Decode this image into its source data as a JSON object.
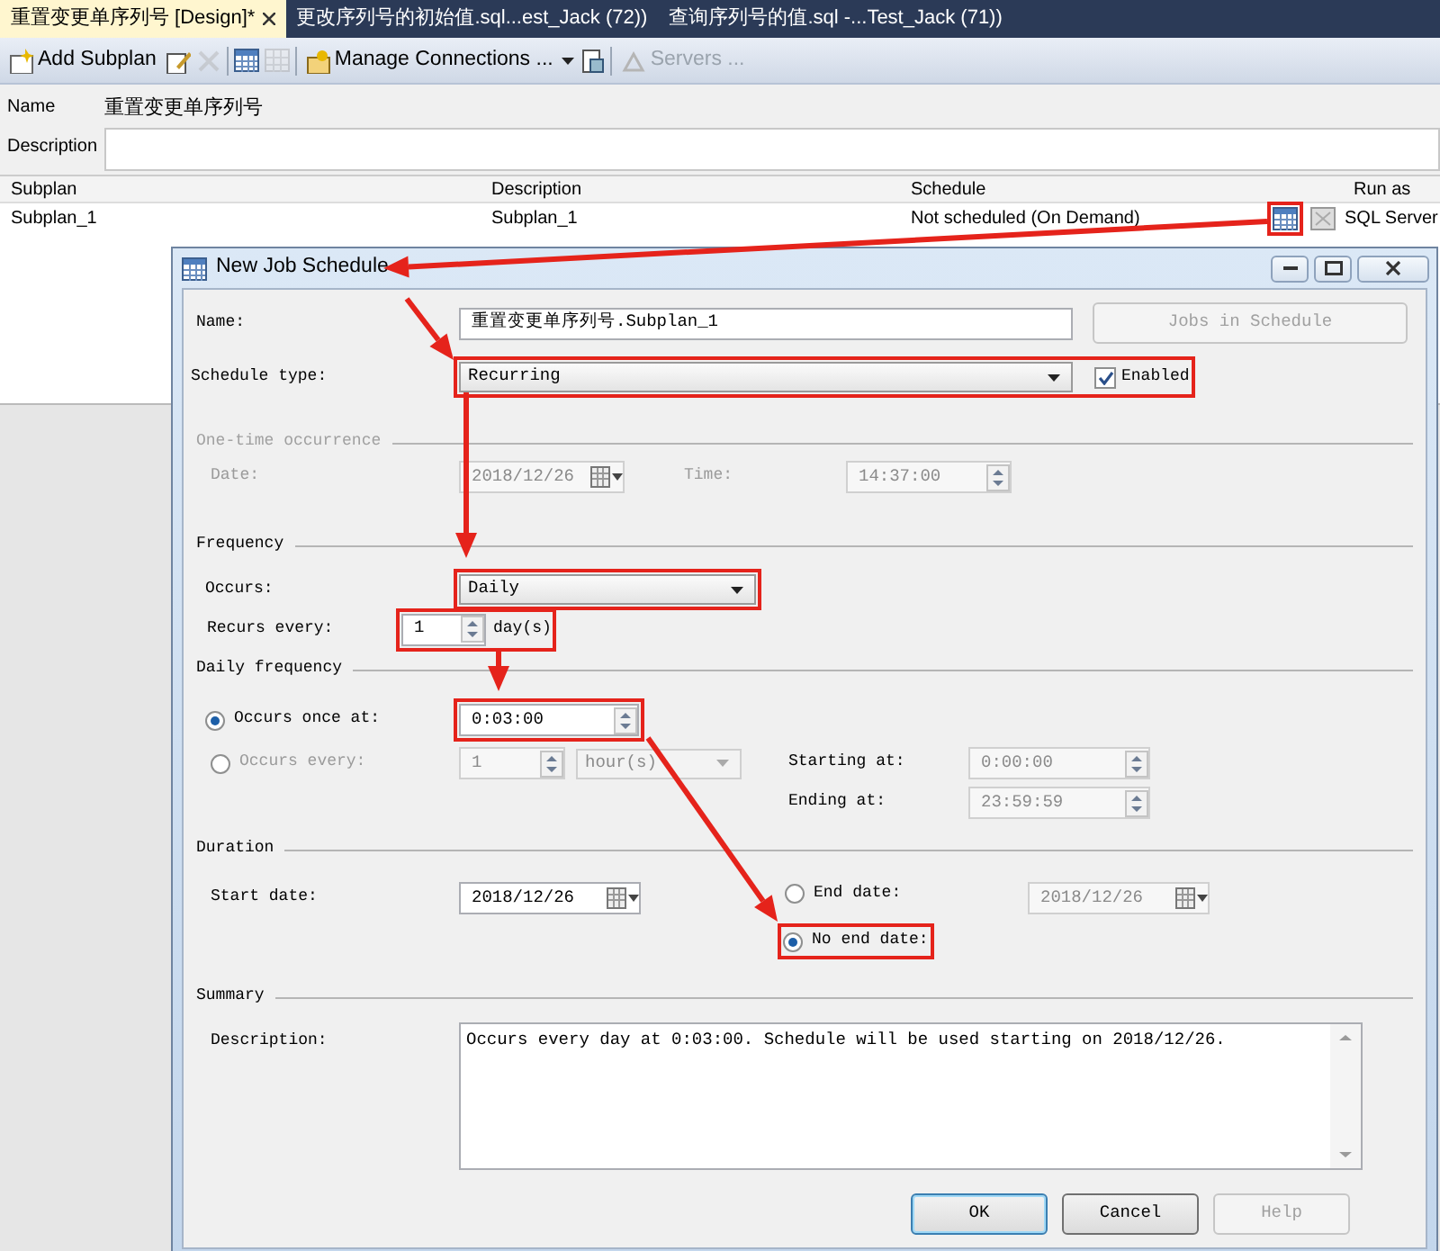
{
  "tabs": [
    {
      "label": "重置变更单序列号 [Design]*",
      "selected": true
    },
    {
      "label": "更改序列号的初始值.sql...est_Jack (72))",
      "selected": false
    },
    {
      "label": "查询序列号的值.sql -...Test_Jack (71))",
      "selected": false
    }
  ],
  "toolbar": [
    {
      "kind": "labeled",
      "label": "Add Subplan",
      "disabled": false
    },
    {
      "kind": "icon",
      "disabled": false
    },
    {
      "kind": "icon",
      "disabled": true
    },
    {
      "kind": "separator"
    },
    {
      "kind": "icon",
      "disabled": false
    },
    {
      "kind": "icon",
      "disabled": true
    },
    {
      "kind": "separator"
    },
    {
      "kind": "labeled",
      "label": "Manage Connections ...",
      "disabled": false,
      "dropdown": true
    },
    {
      "kind": "icon",
      "disabled": false
    },
    {
      "kind": "separator"
    },
    {
      "kind": "labeled",
      "label": "Servers ...",
      "disabled": true
    }
  ],
  "plan": {
    "name_label": "Name",
    "name": "重置变更单序列号",
    "description_label": "Description"
  },
  "subplans": {
    "columns": [
      "Subplan",
      "Description",
      "Schedule",
      "Run as"
    ],
    "rows": [
      {
        "subplan": "Subplan_1",
        "description": "Subplan_1",
        "schedule": "Not scheduled (On Demand)",
        "schedule_button_annotated": true,
        "run_as": "SQL Server"
      }
    ]
  },
  "dialog": {
    "title": "New Job Schedule",
    "name": {
      "label": "Name:",
      "value": "重置变更单序列号.Subplan_1"
    },
    "jobs_button": {
      "label": "Jobs in Schedule",
      "disabled": true
    },
    "schedule_type": {
      "label": "Schedule type:",
      "value": "Recurring",
      "annotated": true
    },
    "enabled": {
      "label": "Enabled",
      "checked": true
    },
    "one_time": {
      "title": "One-time occurrence",
      "disabled": true,
      "date_label": "Date:",
      "date": "2018/12/26",
      "time_label": "Time:",
      "time": "14:37:00"
    },
    "frequency": {
      "title": "Frequency",
      "occurs": {
        "label": "Occurs:",
        "value": "Daily",
        "annotated": true
      },
      "recurs": {
        "label": "Recurs every:",
        "value": "1",
        "unit": "day(s)",
        "annotated": true
      }
    },
    "daily_frequency": {
      "title": "Daily frequency",
      "options": [
        {
          "label": "Occurs once at:",
          "selected": true
        },
        {
          "label": "Occurs every:",
          "selected": false
        }
      ],
      "once_time": {
        "value": "0:03:00",
        "annotated": true
      },
      "every_value": "1",
      "every_unit": "hour(s)",
      "starting_label": "Starting at:",
      "starting": "0:00:00",
      "ending_label": "Ending at:",
      "ending": "23:59:59"
    },
    "duration": {
      "title": "Duration",
      "start_label": "Start date:",
      "start": "2018/12/26",
      "end_options": [
        {
          "label": "End date:",
          "selected": false,
          "annotated": false
        },
        {
          "label": "No end date:",
          "selected": true,
          "annotated": true
        }
      ],
      "end_date": "2018/12/26"
    },
    "summary": {
      "title": "Summary",
      "label": "Description:",
      "text": "Occurs every day at 0:03:00. Schedule will be used starting on 2018/12/26."
    },
    "buttons": [
      {
        "label": "OK",
        "disabled": false,
        "default": true
      },
      {
        "label": "Cancel",
        "disabled": false,
        "default": false
      },
      {
        "label": "Help",
        "disabled": true,
        "default": false
      }
    ]
  }
}
